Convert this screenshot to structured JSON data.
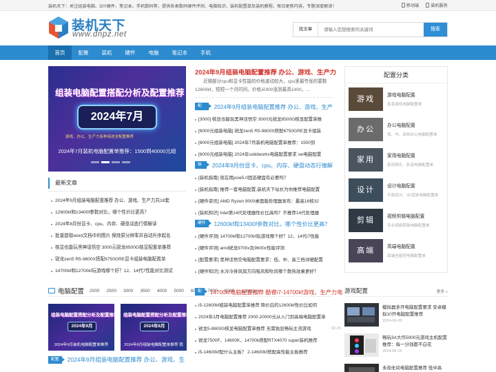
{
  "topbar": {
    "intro": "装机天下：关注组装电脑、DIY硬件、笔记本、手机数码等，提供各类数码硬件评测、电脑知识、装机配置单及装机教程。每日更新内容，专题深度解读！",
    "mobile": "移动端",
    "service": "装机服务"
  },
  "logo": {
    "name": "装机天下",
    "url": "www.dnpz.net"
  },
  "search": {
    "category": "找文章",
    "placeholder": "请输入您想搜索的关键词",
    "button": "搜索"
  },
  "nav": [
    "首页",
    "配置",
    "装机",
    "硬件",
    "电脑",
    "笔记本",
    "手机"
  ],
  "hero": {
    "headline": "组装电脑配置搭配分析及配置推荐",
    "badge": "2024年7月",
    "sub": "游戏、办公、生产力各种用途全配置推荐",
    "caption_l1": "2024年7月装机电脑配置单推荐：1500到40000元组"
  },
  "latest": {
    "title": "最新文章",
    "items": [
      "2024年9月组装电脑配置推荐 办公、游戏、生产力共18套",
      "12600kf和13400f参数对比，哪个性价比更高？",
      "2024年8月份显卡、cpu、内存、硬盘动态行情解读",
      "批量提取word文档中的图片 保持原分辨率并自动升序起名",
      "核显也能玩黑神话悟空 3000元锐龙8500G核显配置单推荐",
      "锐龙zen5 R5-9600X搭配6750GRE显卡组装电脑配置单",
      "14700kf和12700kf玩游戏哪个好？12、14代7性能对比测试"
    ]
  },
  "feature": {
    "title": "2024年9月组装电脑配置推荐 办公、游戏、生产力",
    "desc": "近期部分cpu和显卡性能的价格波动较大，cpu里最夸张的要数12600kf，短短一个月时间，价格从900涨到最高1400，..."
  },
  "groups": [
    {
      "tag": "配置",
      "title": "2024年9月组装电脑配置推荐 办公、游戏、生产",
      "items": [
        "[3000] 核显也能玩黑神话悟空 3000元锐龙8500G核显配置单推",
        "[6000元组装电脑] 锐龙zen5 R5-9600X搭配6750GRE显卡组装",
        "[6000元组装电脑] 2024年7月装机电脑配置单推荐：1500到",
        "[6000元组装电脑] 2024年solidworks电脑配置要求 sw电脑配置"
      ]
    },
    {
      "tag": "装机",
      "title": "2024年8月份显卡、cpu、内存、硬盘动态行情解",
      "items": [
        "[装机指南] 现在用pcie5.0固态硬盘有必要吗？",
        "[装机指南] 推荐一套电脑配置,装机天下站长为你推荐电脑配置",
        "[硬件资讯] AMD Ryzen 9000桌面版处理器发布：最高16核32",
        "[装机知识] Intel第14代处理器性价比高吗？不推荐14代处理器"
      ]
    },
    {
      "tag": "硬件",
      "title": "12600kf和13400f参数对比，哪个性价比更高？",
      "items": [
        "[硬件评测] 14700kf和12700kf玩游戏哪个好？12、14代i7性能",
        "[硬件评测] amd锐龙9700x及9600x性能评测",
        "[配置要求] 黑神话悟空电脑配置要求：低、中、高三档详细配置",
        "[硬件知识] 水冷冷排风扇方向吸风和吹风哪个散热效果更好？"
      ]
    }
  ],
  "sidebar": {
    "title": "配置分类",
    "rows": [
      {
        "thumb": "游戏",
        "title": "游戏电脑配置",
        "sub": "各类游戏电脑配置单",
        "color": "#5a4a3a"
      },
      {
        "thumb": "办公",
        "title": "办公电脑配置",
        "sub": "低、中、高档办公电脑配置单",
        "color": "#6b6b6b"
      },
      {
        "thumb": "家用",
        "title": "家用电脑配置",
        "sub": "家用娱乐、影音电脑配置单",
        "color": "#4a5560"
      },
      {
        "thumb": "设计",
        "title": "设计电脑配置",
        "sub": "平面设计、3D渲染电脑配置单",
        "color": "#3c4d5c"
      },
      {
        "thumb": "剪辑",
        "title": "视频剪辑电脑配置",
        "sub": "专业视频剪辑电脑配置单",
        "color": "#2f3a44"
      },
      {
        "thumb": "高端",
        "title": "高端电脑配置",
        "sub": "高端全能型电脑配置单",
        "color": "#4a4458"
      }
    ]
  },
  "pc_section": {
    "title": "电脑配置",
    "prices": [
      "2000",
      "2500",
      "3000",
      "3500",
      "4000",
      "5000",
      "6000",
      "7000",
      "8000",
      "8000以上"
    ],
    "thumbs": [
      {
        "a": "组装电脑配置搭配分析及配置推荐",
        "b": "2024年9月",
        "c": "2024年9月装机电脑配置单推荐"
      },
      {
        "a": "组装电脑配置搭配分析及配置推荐",
        "b": "2024年8月",
        "c": "2024年8月组装电脑配置单推荐 我"
      }
    ],
    "feature_title": "2024年9月组装电脑配置推荐 办公、游戏、生"
  },
  "pc_group": {
    "tag": "配置",
    "title": "14700kf电脑配置推荐 酷睿i7-14700kf游戏、生产力电",
    "items": [
      {
        "t": "i5-12600kf组装电脑配置单推荐 降价后的12600kf性价比如何",
        "d": ""
      },
      {
        "t": "2024年3月电脑配置推荐 2000-20000元从入门到高端电脑配置单",
        "d": ""
      },
      {
        "t": "锐龙5-8600G核显电脑配置单推荐 无需独显畅玩主流游戏",
        "d": "02-15"
      },
      {
        "t": "锐龙7500F、14600K、14700k搭配RTX4070 super装机推荐",
        "d": ""
      },
      {
        "t": "i5-14600kf配什么主板？ 2-14600kf搭配高性能主板推荐",
        "d": ""
      }
    ]
  },
  "game": {
    "title": "游戏配置",
    "more": "更多 »",
    "items": [
      {
        "t": "模拟器多开电脑配置要求 安卓模拟10开电脑配置推荐",
        "d": "2024-06-05"
      },
      {
        "t": "畅玩3A大作5000元游戏主机配置推荐：每一分钱都不白花",
        "d": "2024-06-15"
      },
      {
        "t": "永劫无间电脑配置推荐 低中高",
        "d": ""
      }
    ]
  },
  "colors": {
    "brand": "#2d8bcf",
    "accent_red": "#d0352d"
  }
}
